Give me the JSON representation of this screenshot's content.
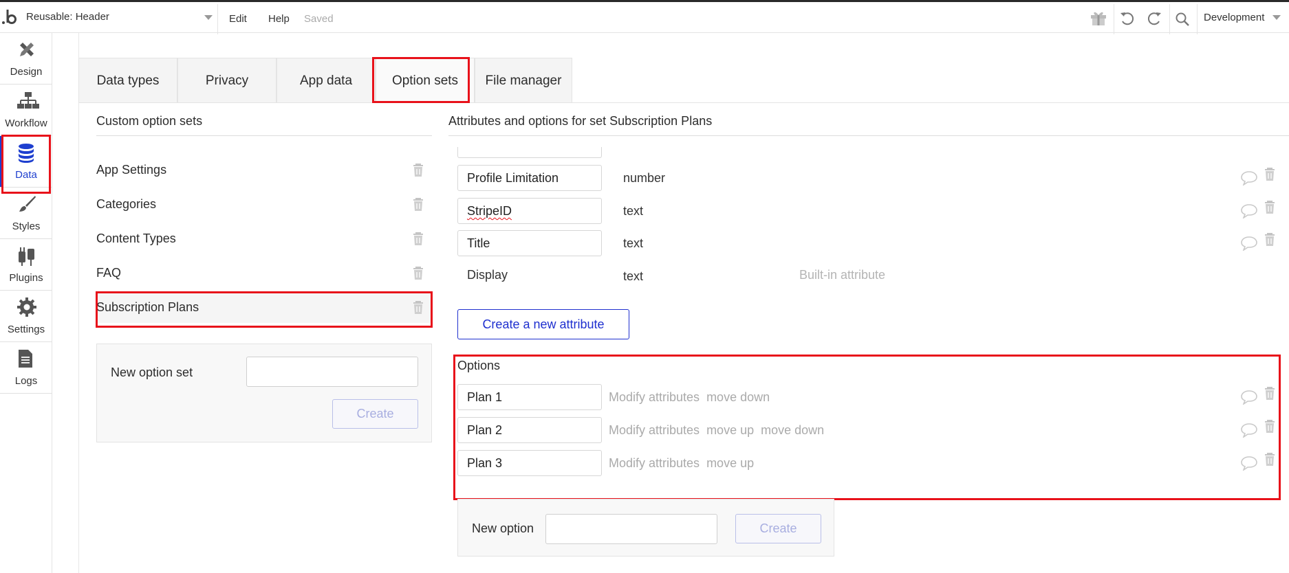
{
  "topbar": {
    "page_name": "Reusable: Header",
    "menu": {
      "edit": "Edit",
      "help": "Help"
    },
    "save_status": "Saved",
    "environment": "Development",
    "icons": [
      "gift-icon",
      "undo-icon",
      "redo-icon",
      "search-icon"
    ]
  },
  "sidebar": {
    "items": [
      {
        "label": "Design",
        "icon": "design-icon"
      },
      {
        "label": "Workflow",
        "icon": "workflow-icon"
      },
      {
        "label": "Data",
        "icon": "database-icon",
        "active": true
      },
      {
        "label": "Styles",
        "icon": "brush-icon"
      },
      {
        "label": "Plugins",
        "icon": "plug-icon"
      },
      {
        "label": "Settings",
        "icon": "gear-icon"
      },
      {
        "label": "Logs",
        "icon": "document-icon"
      }
    ]
  },
  "tabs": [
    {
      "label": "Data types"
    },
    {
      "label": "Privacy"
    },
    {
      "label": "App data"
    },
    {
      "label": "Option sets",
      "active": true
    },
    {
      "label": "File manager"
    }
  ],
  "left_panel": {
    "title": "Custom option sets",
    "sets": [
      "App Settings",
      "Categories",
      "Content Types",
      "FAQ",
      "Subscription Plans"
    ],
    "selected_set": "Subscription Plans",
    "new_set_label": "New option set",
    "new_set_value": "",
    "create_label": "Create"
  },
  "right_panel": {
    "title": "Attributes and options for set Subscription Plans",
    "attributes": [
      {
        "name": "Profile Limitation",
        "type": "number"
      },
      {
        "name": "StripeID",
        "type": "text"
      },
      {
        "name": "Title",
        "type": "text"
      }
    ],
    "builtin_attribute": {
      "name": "Display",
      "type": "text",
      "note": "Built-in attribute"
    },
    "create_attribute_label": "Create a new attribute",
    "options_title": "Options",
    "options": [
      {
        "name": "Plan 1",
        "actions": [
          "Modify attributes",
          "move down"
        ]
      },
      {
        "name": "Plan 2",
        "actions": [
          "Modify attributes",
          "move up",
          "move down"
        ]
      },
      {
        "name": "Plan 3",
        "actions": [
          "Modify attributes",
          "move up"
        ]
      }
    ],
    "new_option_label": "New option",
    "new_option_value": "",
    "create_label": "Create"
  },
  "highlight_color": "#e8111a",
  "accent_color": "#1e3fcf"
}
